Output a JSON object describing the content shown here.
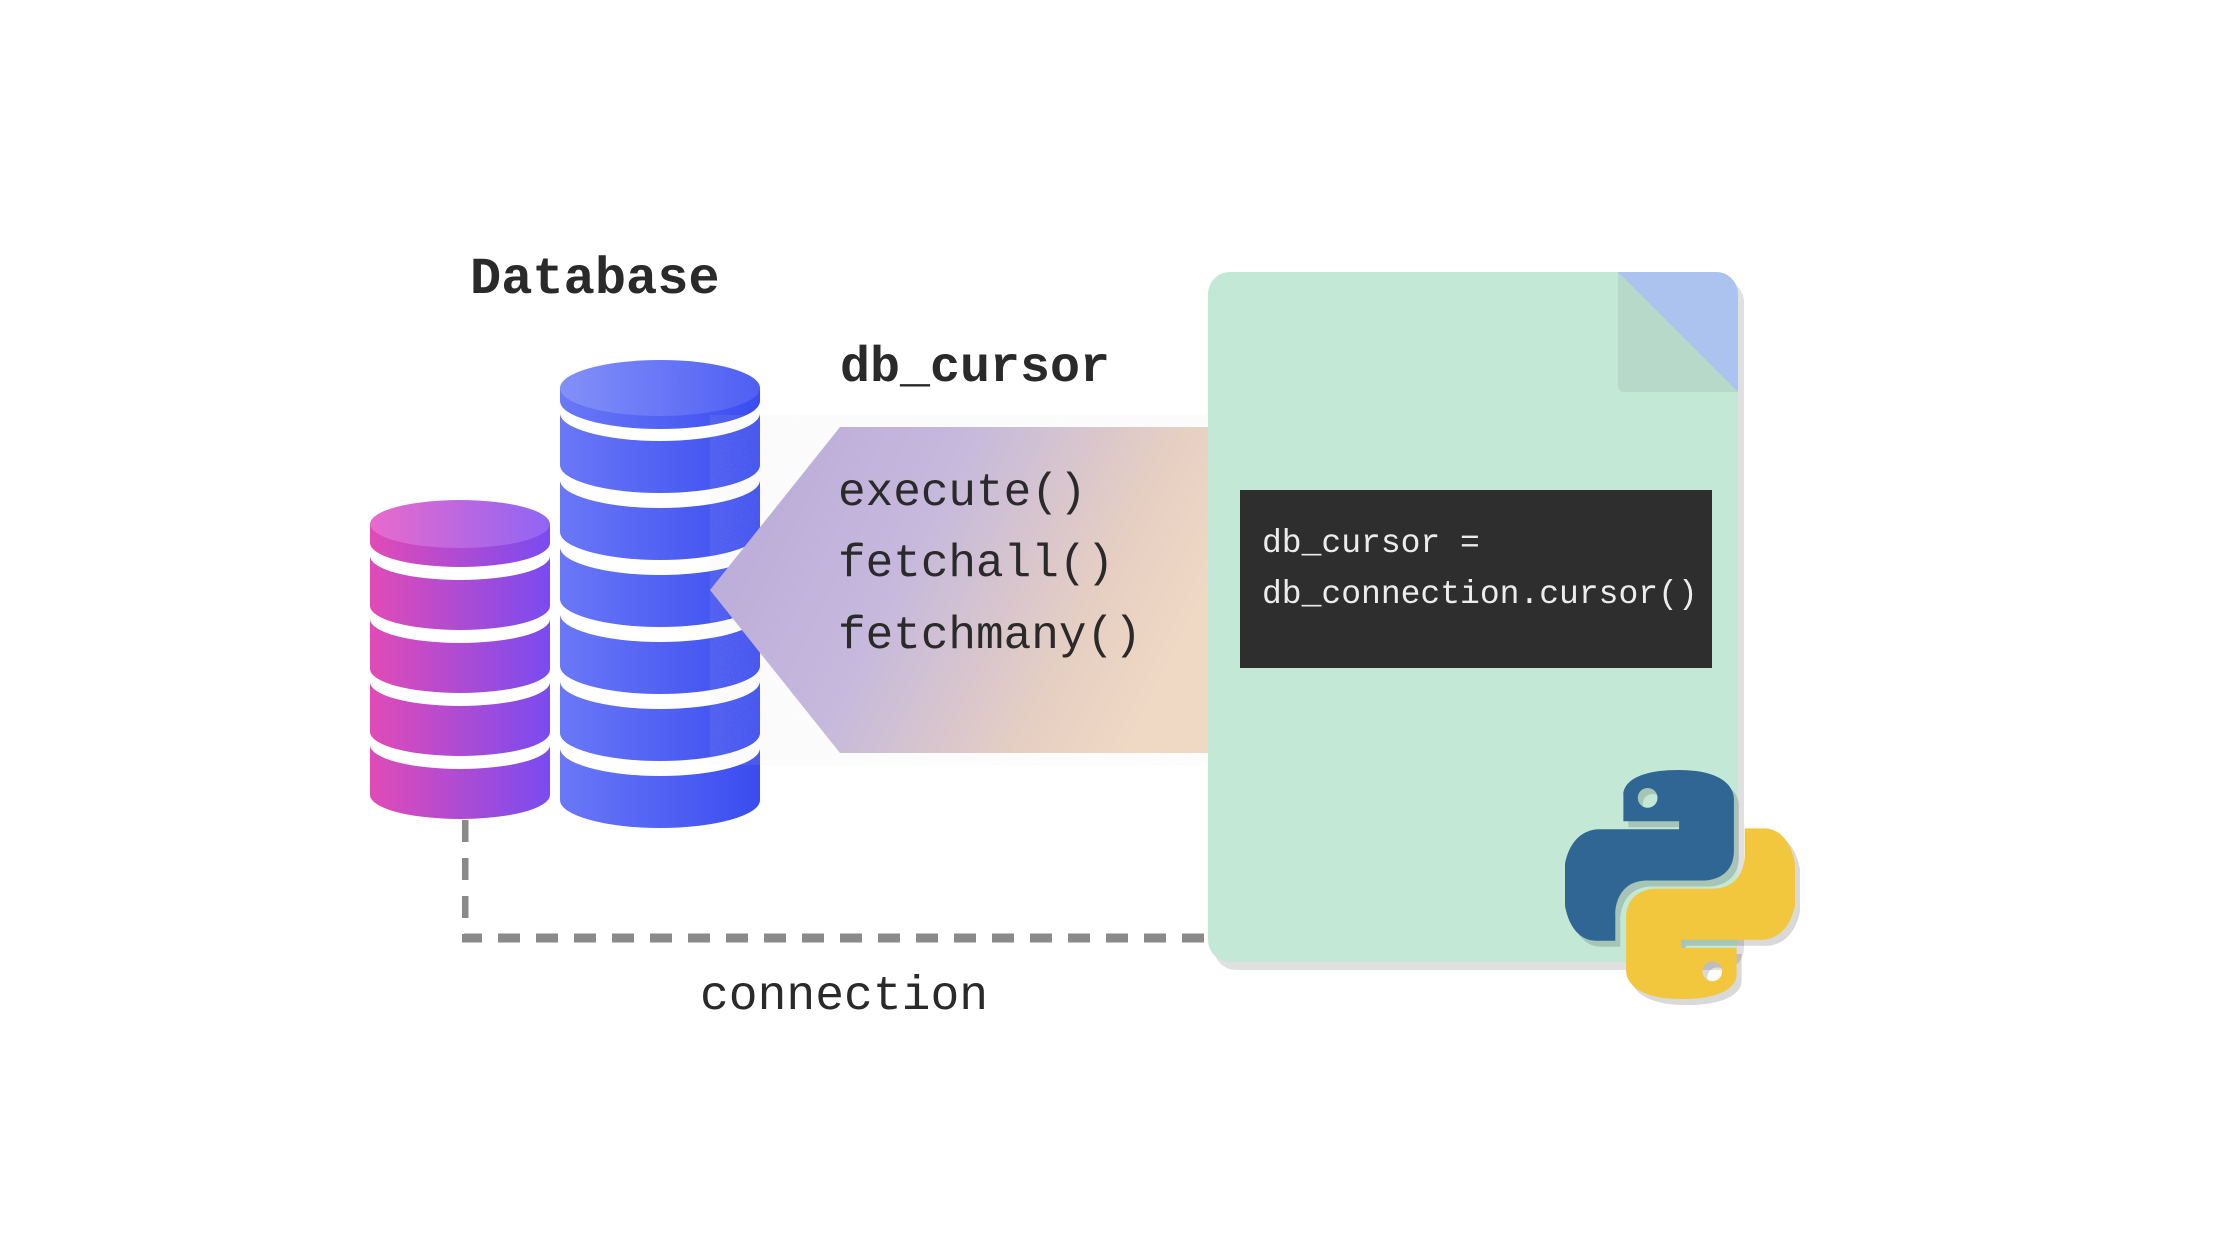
{
  "labels": {
    "database": "Database",
    "cursor_title": "db_cursor",
    "connection": "connection"
  },
  "cursor_methods": {
    "m1": "execute()",
    "m2": "fetchall()",
    "m3": "fetchmany()"
  },
  "code": {
    "line1": "db_cursor =",
    "line2": "db_connection.cursor()"
  },
  "colors": {
    "file_bg": "#c4e8d6",
    "file_fold": "#adc3ef",
    "code_bg": "#2e2e2e",
    "db_left_a": "#d84bb0",
    "db_left_b": "#8a4bf0",
    "db_right_a": "#5a6af5",
    "db_right_b": "#3a4cf0",
    "python_blue": "#2f6693",
    "python_yellow": "#f2c73d"
  },
  "icons": {
    "database_left": "database-cylinder-pink-icon",
    "database_right": "database-cylinder-blue-icon",
    "file": "python-file-icon",
    "python": "python-logo-icon",
    "arrow": "cursor-arrow-icon"
  }
}
